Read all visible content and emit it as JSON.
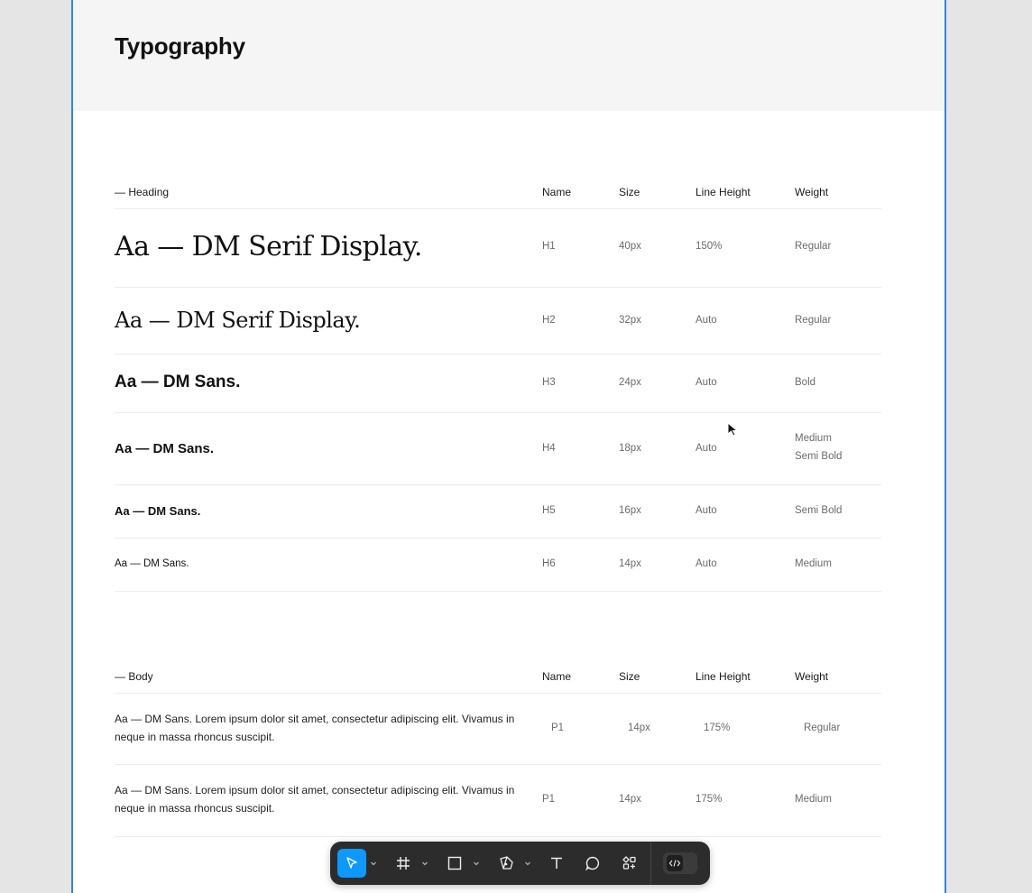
{
  "frame": {
    "title": "Typography"
  },
  "columns": {
    "name": "Name",
    "size": "Size",
    "line_height": "Line Height",
    "weight": "Weight"
  },
  "heading_section": {
    "label": "— Heading",
    "rows": [
      {
        "sample": "Aa —  DM Serif Display.",
        "name": "H1",
        "size": "40px",
        "line_height": "150%",
        "weight": "Regular",
        "weight2": ""
      },
      {
        "sample": "Aa —  DM Serif Display.",
        "name": "H2",
        "size": "32px",
        "line_height": "Auto",
        "weight": "Regular",
        "weight2": ""
      },
      {
        "sample": "Aa —  DM Sans.",
        "name": "H3",
        "size": "24px",
        "line_height": "Auto",
        "weight": "Bold",
        "weight2": ""
      },
      {
        "sample": "Aa —  DM Sans.",
        "name": "H4",
        "size": "18px",
        "line_height": "Auto",
        "weight": "Medium",
        "weight2": "Semi Bold"
      },
      {
        "sample": "Aa —  DM Sans.",
        "name": "H5",
        "size": "16px",
        "line_height": "Auto",
        "weight": "Semi Bold",
        "weight2": ""
      },
      {
        "sample": "Aa —  DM Sans.",
        "name": "H6",
        "size": "14px",
        "line_height": "Auto",
        "weight": "Medium",
        "weight2": ""
      }
    ]
  },
  "body_section": {
    "label": "— Body",
    "rows": [
      {
        "sample": "Aa —  DM Sans. Lorem ipsum dolor sit amet, consectetur adipiscing elit. Vivamus in neque in massa rhoncus suscipit.",
        "name": "P1",
        "size": "14px",
        "line_height": "175%",
        "weight": "Regular"
      },
      {
        "sample": "Aa —  DM Sans. Lorem ipsum dolor sit amet, consectetur adipiscing elit. Vivamus in neque in massa rhoncus suscipit.",
        "name": "P1",
        "size": "14px",
        "line_height": "175%",
        "weight": "Medium"
      }
    ]
  },
  "toolbar": {
    "tools": [
      "move-tool",
      "frame-tool",
      "shape-tool",
      "pen-tool",
      "text-tool",
      "comment-tool",
      "actions-tool"
    ],
    "active_tool": "move-tool",
    "dev_mode_icon": "code-icon"
  },
  "colors": {
    "accent": "#0d99ff",
    "frame_border": "#2b88e0",
    "toolbar_bg": "#2c2c2c"
  }
}
